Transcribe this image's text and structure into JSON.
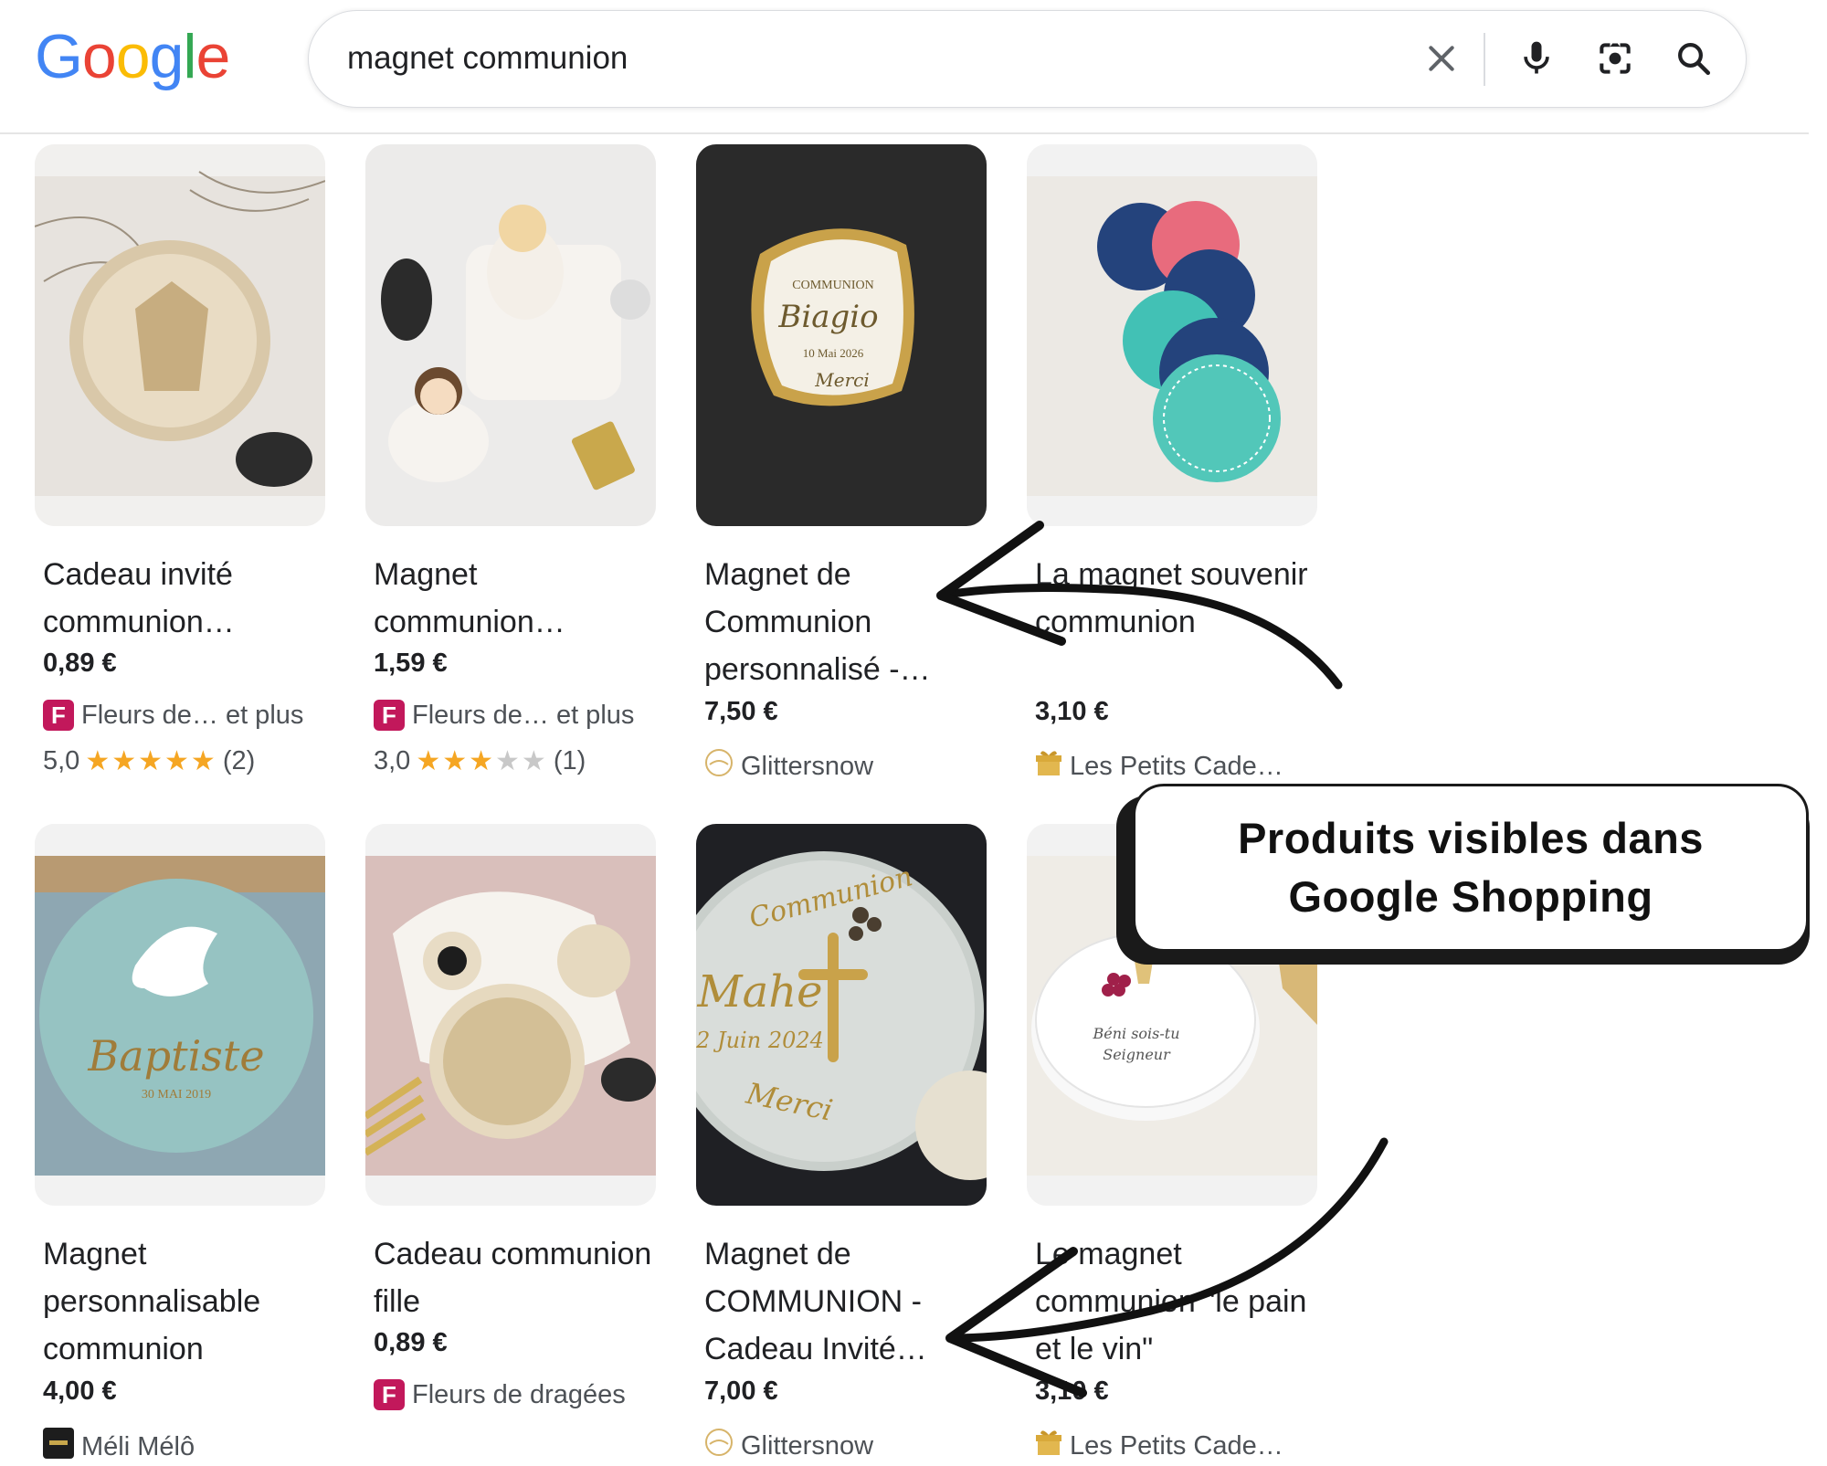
{
  "header": {
    "logo_letters": [
      "G",
      "o",
      "o",
      "g",
      "l",
      "e"
    ],
    "logo_colors": [
      "#4285F4",
      "#EA4335",
      "#FBBC05",
      "#4285F4",
      "#34A853",
      "#EA4335"
    ],
    "search_query": "magnet communion",
    "icons": [
      "close-icon",
      "microphone-icon",
      "lens-icon",
      "search-icon"
    ]
  },
  "products": [
    {
      "title": "Cadeau invité communion…",
      "price": "0,89 €",
      "seller": "Fleurs de… et plus",
      "seller_icon": "fleurs-favicon",
      "rating": "5,0",
      "stars": 5,
      "reviews": "(2)"
    },
    {
      "title": "Magnet communion…",
      "price": "1,59 €",
      "seller": "Fleurs de… et plus",
      "seller_icon": "fleurs-favicon",
      "rating": "3,0",
      "stars": 3,
      "reviews": "(1)"
    },
    {
      "title": "Magnet de Communion personnalisé -…",
      "price": "7,50 €",
      "seller": "Glittersnow",
      "seller_icon": "glittersnow-favicon"
    },
    {
      "title": "La magnet souvenir communion",
      "price": "3,10 €",
      "seller": "Les Petits Cade…",
      "seller_icon": "gift-favicon"
    },
    {
      "title": "Magnet personnalisable communion",
      "price": "4,00 €",
      "seller": "Méli Mélô",
      "seller_icon": "meli-favicon"
    },
    {
      "title": "Cadeau communion fille",
      "price": "0,89 €",
      "seller": "Fleurs de dragées",
      "seller_icon": "fleurs-favicon"
    },
    {
      "title": "Magnet de COMMUNION - Cadeau Invité…",
      "price": "7,00 €",
      "seller": "Glittersnow",
      "seller_icon": "glittersnow-favicon"
    },
    {
      "title": "Le magnet communion \"le pain et le vin\"",
      "price": "3,10 €",
      "seller": "Les Petits Cade…",
      "seller_icon": "gift-favicon"
    }
  ],
  "image_text": {
    "p3_line1": "COMMUNION",
    "p3_line2": "Biagio",
    "p3_line3": "10 Mai 2026",
    "p3_line4": "Merci",
    "p5_name": "Baptiste",
    "p5_date": "30 MAI 2019",
    "p7_line1": "Communion",
    "p7_line2": "Mahé",
    "p7_line3": "2 Juin 2024",
    "p7_line4": "Merci",
    "p8_line1": "Béni sois-tu",
    "p8_line2": "Seigneur"
  },
  "callout": {
    "line1": "Produits visibles dans",
    "line2": "Google Shopping"
  }
}
